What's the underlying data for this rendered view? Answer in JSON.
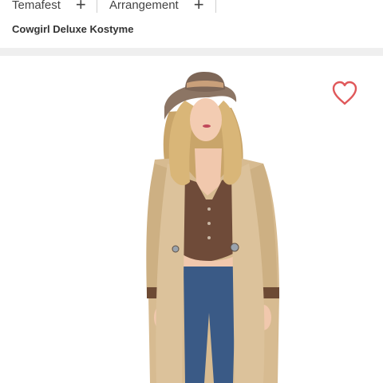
{
  "nav": {
    "items": [
      {
        "label": "Temafest",
        "plus": "+"
      },
      {
        "label": "Arrangement",
        "plus": "+"
      }
    ]
  },
  "product": {
    "title": "Cowgirl Deluxe Kostyme"
  },
  "icons": {
    "favorite": "heart-outline-icon",
    "expand": "plus-icon"
  },
  "colors": {
    "favorite": "#e0585a",
    "band": "#efefef",
    "text": "#333333"
  }
}
